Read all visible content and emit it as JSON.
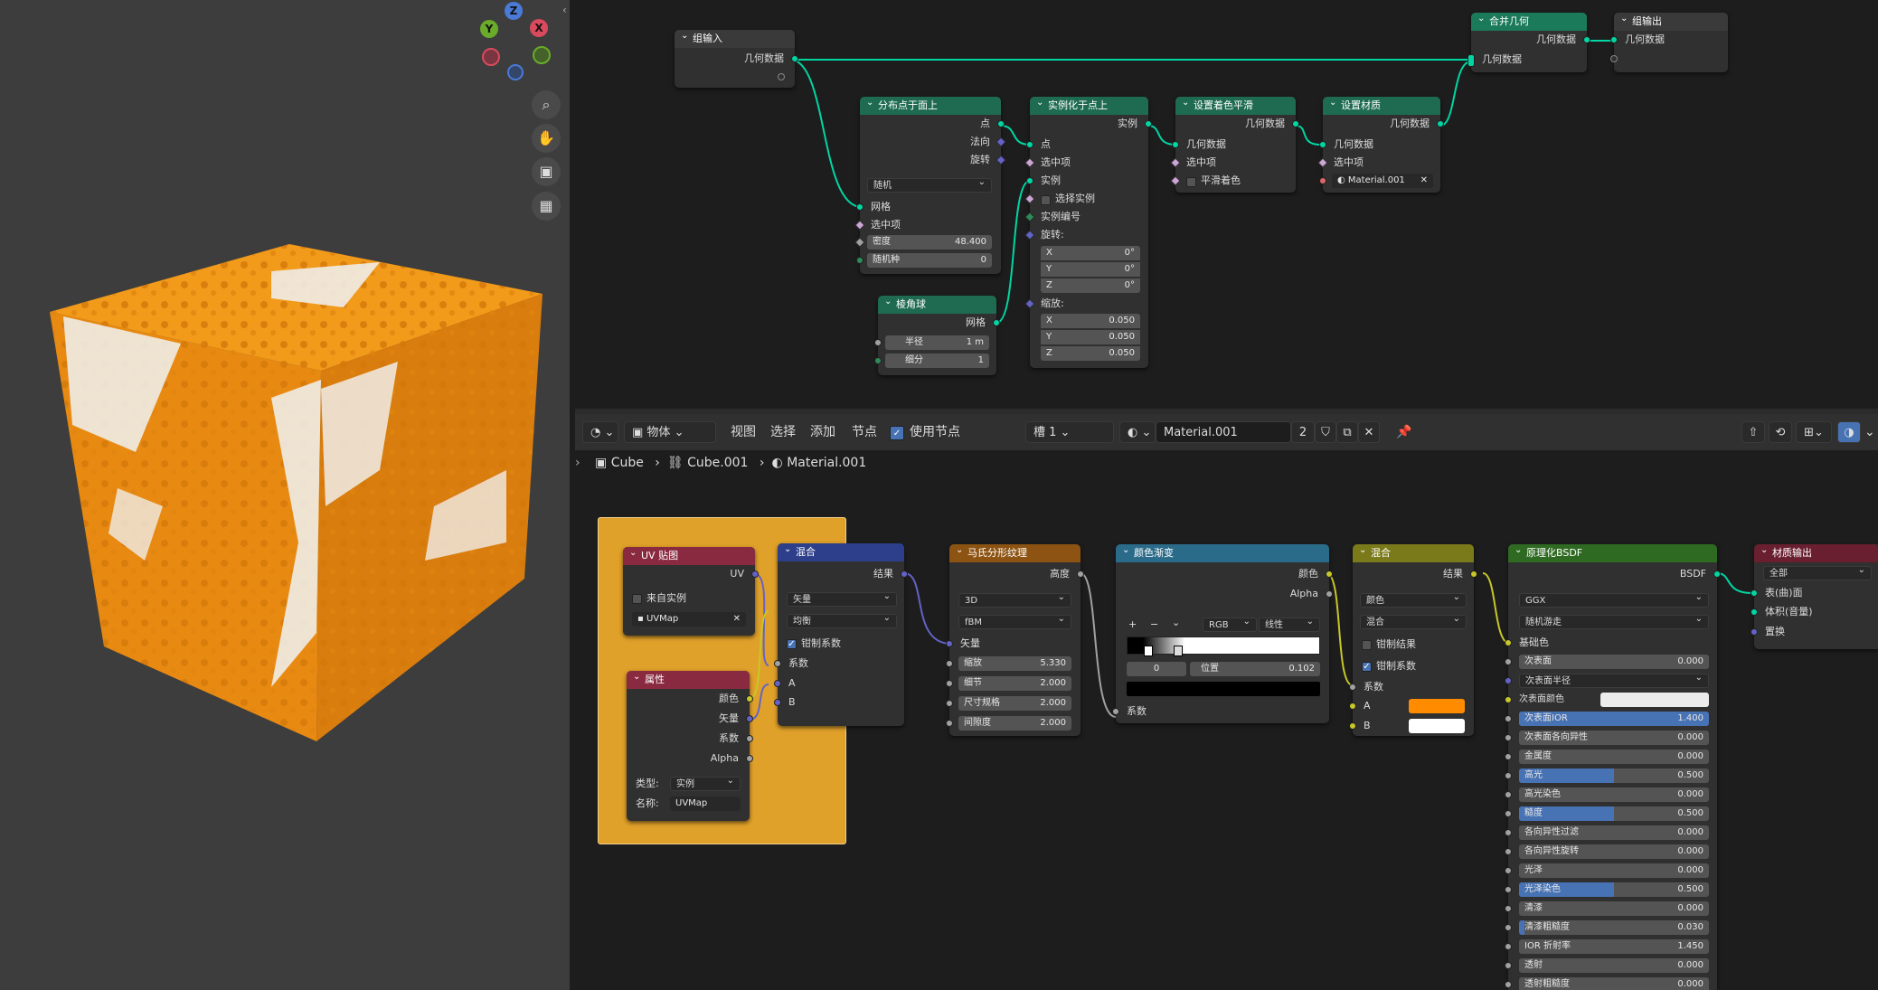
{
  "viewport": {
    "gizmo": {
      "z": "Z",
      "y": "Y",
      "x": "X"
    },
    "tools": [
      "zoom-icon",
      "hand-icon",
      "camera-icon",
      "grid-icon"
    ]
  },
  "geo_nodes": {
    "group_input": {
      "title": "组输入",
      "out": "几何数据"
    },
    "join": {
      "title": "合并几何",
      "out": "几何数据",
      "in": "几何数据"
    },
    "group_output": {
      "title": "组输出",
      "in": "几何数据"
    },
    "distribute": {
      "title": "分布点于面上",
      "outs": [
        "点",
        "法向",
        "旋转"
      ],
      "mode": "随机",
      "ins": [
        "网格",
        "选中项"
      ],
      "density_label": "密度",
      "density": "48.400",
      "seed_label": "随机种",
      "seed": "0"
    },
    "instance": {
      "title": "实例化于点上",
      "out": "实例",
      "ins": [
        "点",
        "选中项",
        "实例"
      ],
      "pick": "选择实例",
      "ins2": [
        "实例编号",
        "旋转:"
      ],
      "rot": [
        {
          "k": "X",
          "v": "0°"
        },
        {
          "k": "Y",
          "v": "0°"
        },
        {
          "k": "Z",
          "v": "0°"
        }
      ],
      "scale_label": "缩放:",
      "scale": [
        {
          "k": "X",
          "v": "0.050"
        },
        {
          "k": "Y",
          "v": "0.050"
        },
        {
          "k": "Z",
          "v": "0.050"
        }
      ]
    },
    "ico": {
      "title": "棱角球",
      "out": "网格",
      "radius_label": "半径",
      "radius": "1 m",
      "sub_label": "细分",
      "sub": "1"
    },
    "smooth": {
      "title": "设置着色平滑",
      "out": "几何数据",
      "ins": [
        "几何数据",
        "选中项"
      ],
      "smooth": "平滑着色"
    },
    "material": {
      "title": "设置材质",
      "out": "几何数据",
      "ins": [
        "几何数据",
        "选中项"
      ],
      "mat": "Material.001"
    }
  },
  "shader_header": {
    "editor": "物体",
    "menus": [
      "视图",
      "选择",
      "添加",
      "节点"
    ],
    "use_nodes": "使用节点",
    "slot": "槽 1",
    "material": "Material.001",
    "users": "2"
  },
  "breadcrumb": [
    "Cube",
    "Cube.001",
    "Material.001"
  ],
  "shader_nodes": {
    "uv": {
      "title": "UV 贴图",
      "out": "UV",
      "from_inst": "来自实例",
      "map": "UVMap"
    },
    "attr": {
      "title": "属性",
      "outs": [
        "颜色",
        "矢量",
        "系数",
        "Alpha"
      ],
      "type_label": "类型:",
      "type": "实例",
      "name_label": "名称:",
      "name": "UVMap"
    },
    "mix": {
      "title": "混合",
      "out": "结果",
      "a": "矢量",
      "b": "均衡",
      "clamp": "钳制系数",
      "ins": [
        "系数",
        "A",
        "B"
      ]
    },
    "musgrave": {
      "title": "马氏分形纹理",
      "out": "高度",
      "dim": "3D",
      "type": "fBM",
      "in": "矢量",
      "fields": [
        {
          "k": "缩放",
          "v": "5.330"
        },
        {
          "k": "细节",
          "v": "2.000"
        },
        {
          "k": "尺寸规格",
          "v": "2.000"
        },
        {
          "k": "间隙度",
          "v": "2.000"
        }
      ]
    },
    "ramp": {
      "title": "颜色渐变",
      "outs": [
        "颜色",
        "Alpha"
      ],
      "mode": "RGB",
      "interp": "线性",
      "idx": "0",
      "pos_label": "位置",
      "pos": "0.102",
      "in": "系数"
    },
    "mix2": {
      "title": "混合",
      "out": "结果",
      "a": "颜色",
      "b": "混合",
      "clamp_res": "钳制结果",
      "clamp": "钳制系数",
      "ins": [
        "系数",
        "A",
        "B"
      ],
      "color_a": "#ff8c00",
      "color_b": "#ffffff"
    },
    "bsdf": {
      "title": "原理化BSDF",
      "out": "BSDF",
      "dist": "GGX",
      "sss": "随机游走",
      "base": "基础色",
      "sub_label": "次表面",
      "sub": "0.000",
      "subr": "次表面半径",
      "subc": "次表面颜色",
      "props": [
        {
          "k": "次表面IOR",
          "v": "1.400",
          "f": 1
        },
        {
          "k": "次表面各向异性",
          "v": "0.000",
          "f": 0
        },
        {
          "k": "金属度",
          "v": "0.000",
          "f": 0
        },
        {
          "k": "高光",
          "v": "0.500",
          "f": 0.5
        },
        {
          "k": "高光染色",
          "v": "0.000",
          "f": 0
        },
        {
          "k": "糙度",
          "v": "0.500",
          "f": 0.5
        },
        {
          "k": "各向异性过滤",
          "v": "0.000",
          "f": 0
        },
        {
          "k": "各向异性旋转",
          "v": "0.000",
          "f": 0
        },
        {
          "k": "光泽",
          "v": "0.000",
          "f": 0
        },
        {
          "k": "光泽染色",
          "v": "0.500",
          "f": 0.5
        },
        {
          "k": "清漆",
          "v": "0.000",
          "f": 0
        },
        {
          "k": "清漆粗糙度",
          "v": "0.030",
          "f": 0.03
        },
        {
          "k": "IOR 折射率",
          "v": "1.450",
          "f": 0
        },
        {
          "k": "透射",
          "v": "0.000",
          "f": 0
        },
        {
          "k": "透射粗糙度",
          "v": "0.000",
          "f": 0
        }
      ]
    },
    "out": {
      "title": "材质输出",
      "target": "全部",
      "ins": [
        "表(曲)面",
        "体积(音量)",
        "置换"
      ]
    }
  }
}
